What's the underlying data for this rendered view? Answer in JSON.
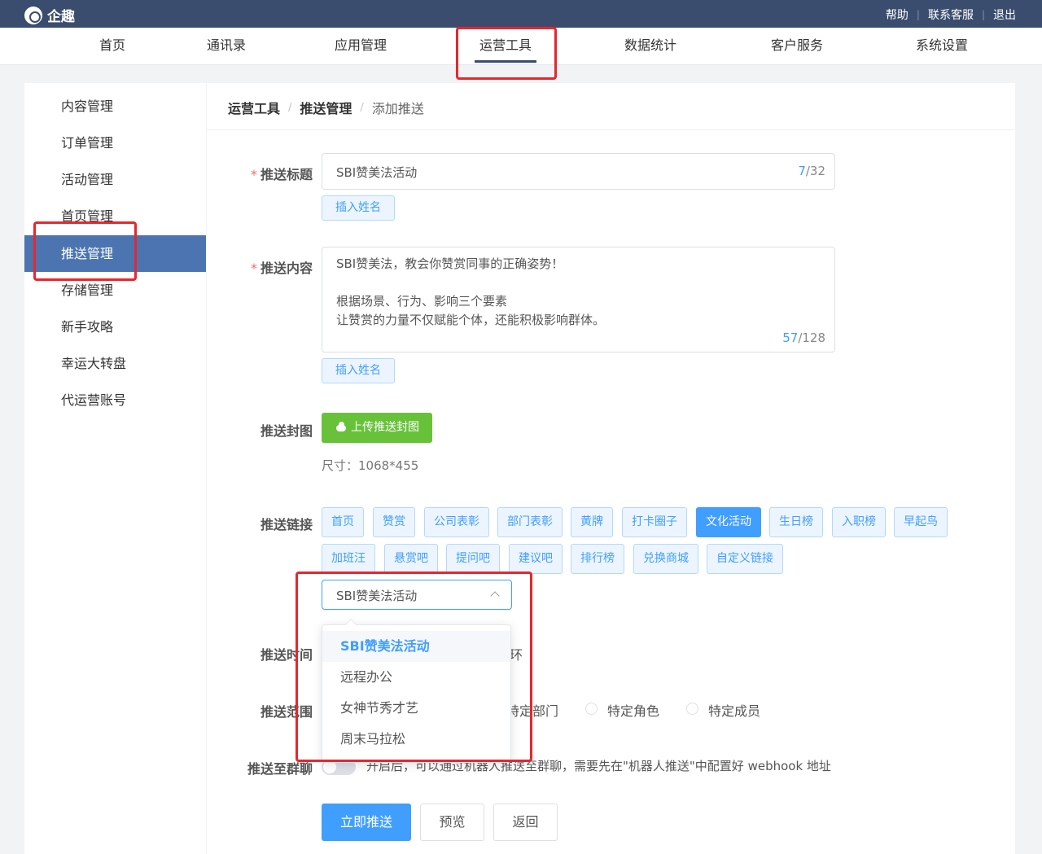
{
  "app": {
    "name": "企趣"
  },
  "top_links": [
    "帮助",
    "联系客服",
    "退出"
  ],
  "nav": [
    "首页",
    "通讯录",
    "应用管理",
    "运营工具",
    "数据统计",
    "客户服务",
    "系统设置"
  ],
  "sidebar": [
    "内容管理",
    "订单管理",
    "活动管理",
    "首页管理",
    "推送管理",
    "存储管理",
    "新手攻略",
    "幸运大转盘",
    "代运营账号"
  ],
  "breadcrumb": [
    "运营工具",
    "推送管理",
    "添加推送"
  ],
  "form": {
    "title_label": "推送标题",
    "title_value": "SBI赞美法活动",
    "title_count": "7",
    "title_max": "/32",
    "insert_name": "插入姓名",
    "content_label": "推送内容",
    "content_lines": [
      "SBI赞美法，教会你赞赏同事的正确姿势！",
      "",
      "根据场景、行为、影响三个要素",
      "让赞赏的力量不仅赋能个体，还能积极影响群体。"
    ],
    "content_count": "57",
    "content_max": "/128",
    "cover_label": "推送封图",
    "upload_button": "上传推送封图",
    "size_hint": "尺寸：1068*455",
    "link_label": "推送链接",
    "link_tags": [
      "首页",
      "赞赏",
      "公司表彰",
      "部门表彰",
      "黄牌",
      "打卡圈子",
      "文化活动",
      "生日榜",
      "入职榜",
      "早起鸟",
      "加班汪",
      "悬赏吧",
      "提问吧",
      "建议吧",
      "排行榜",
      "兑换商城",
      "自定义链接"
    ],
    "active_tag": "文化活动",
    "select_value": "SBI赞美法活动",
    "dropdown_options": [
      "SBI赞美法活动",
      "远程办公",
      "女神节秀才艺",
      "周末马拉松"
    ],
    "time_label": "推送时间",
    "time_fragment": "环",
    "scope_label": "推送范围",
    "scope_options": [
      "特定部门",
      "特定角色",
      "特定成员"
    ],
    "group_label": "推送至群聊",
    "group_hint": "开启后，可以通过机器人推送至群聊，需要先在\"机器人推送\"中配置好 webhook 地址",
    "buttons": {
      "submit": "立即推送",
      "preview": "预览",
      "back": "返回"
    }
  },
  "colors": {
    "topbar": "#3a4d6e",
    "primary": "#409eff",
    "success": "#67c23a",
    "sidebar_active": "#4b74b0",
    "highlight": "#e8262d"
  }
}
